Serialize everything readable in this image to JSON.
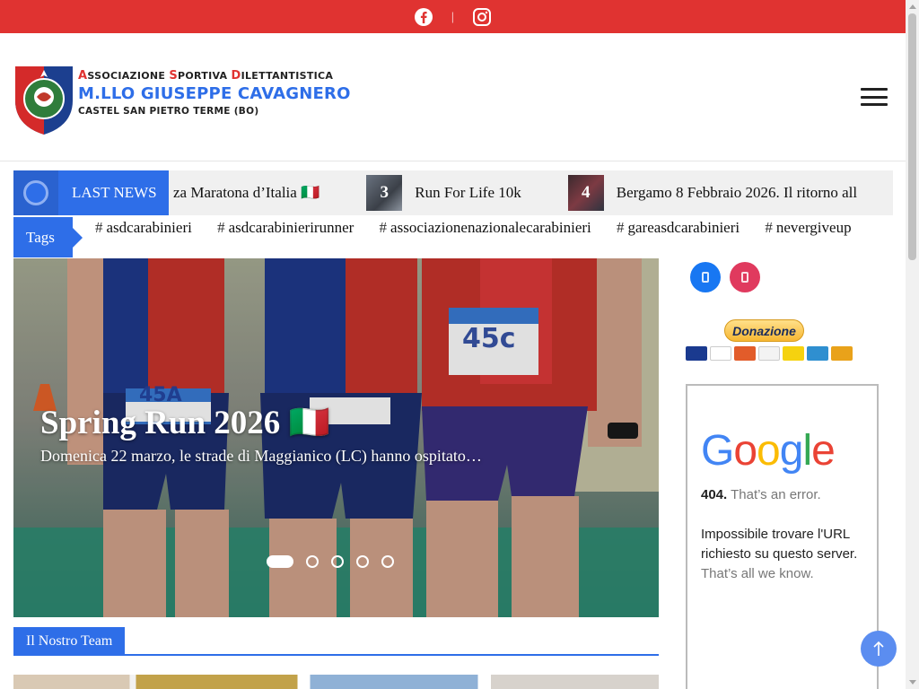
{
  "topbar": {
    "separator": "|",
    "icons": [
      "facebook-icon",
      "instagram-icon"
    ]
  },
  "brand": {
    "line1": [
      "A",
      "SSOCIAZIONE ",
      "S",
      "PORTIVA ",
      "D",
      "ILETTANTISTICA"
    ],
    "line2": "M.LLO GIUSEPPE CAVAGNERO",
    "line3": "CASTEL SAN PIETRO TERME (BO)"
  },
  "ticker": {
    "label": "LAST NEWS",
    "items": [
      {
        "num": "",
        "title": "za Maratona d’Italia 🇮🇹"
      },
      {
        "num": "3",
        "title": "Run For Life 10k"
      },
      {
        "num": "4",
        "title": "Bergamo 8 Febbraio 2026. Il ritorno all"
      }
    ]
  },
  "tags": {
    "label": "Tags",
    "items": [
      "asdcarabinieri",
      "asdcarabinierirunner",
      "associazionenazionalecarabinieri",
      "gareasdcarabinieri",
      "nevergiveup"
    ]
  },
  "slider": {
    "title": "Spring Run 2026 🇮🇹",
    "excerpt": "Domenica 22 marzo, le strade di Maggianico (LC) hanno ospitato…",
    "bibs": [
      "45A",
      "45c"
    ],
    "dots": 5,
    "active_dot": 1
  },
  "team": {
    "heading": "Il Nostro Team"
  },
  "sidebar": {
    "donate": "Donazione",
    "error_box": {
      "logo": "Google",
      "code": "404.",
      "code_text": "That’s an error.",
      "message": "Impossibile trovare l'URL richiesto su questo server.",
      "footer": "That’s all we know."
    }
  },
  "colors": {
    "red": "#e03331",
    "blue": "#2e6ee8"
  }
}
